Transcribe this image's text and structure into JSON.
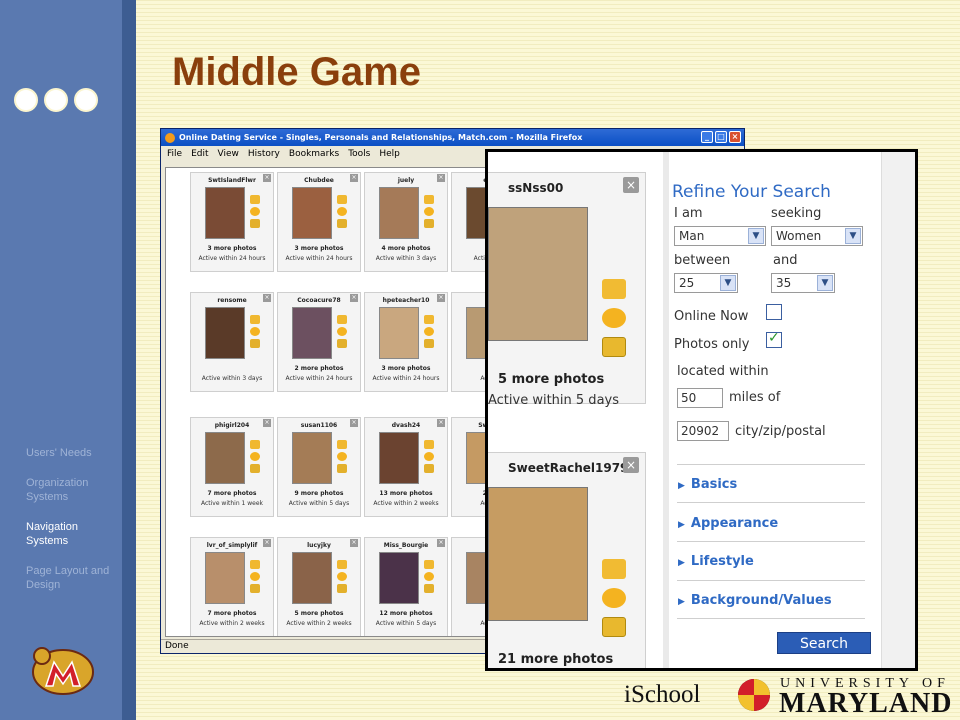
{
  "slide": {
    "title": "Middle Game",
    "nav": [
      "Users' Needs",
      "Organization Systems",
      "Navigation Systems",
      "Page Layout and Design"
    ],
    "active_nav": "Navigation Systems",
    "footer": {
      "ischool": "iSchool",
      "university_top": "UNIVERSITY OF",
      "university_bottom": "MARYLAND"
    }
  },
  "browser": {
    "title": "Online Dating Service - Singles, Personals and Relationships, Match.com - Mozilla Firefox",
    "menu": [
      "File",
      "Edit",
      "View",
      "History",
      "Bookmarks",
      "Tools",
      "Help"
    ],
    "status": "Done",
    "profiles": [
      {
        "name": "SwtIslandFlwr",
        "more": "3 more photos",
        "active": "Active within 24 hours",
        "photo_color": "#7a4b35"
      },
      {
        "name": "Chubdee",
        "more": "3 more photos",
        "active": "Active within 24 hours",
        "photo_color": "#9b6040"
      },
      {
        "name": "juely",
        "more": "4 more photos",
        "active": "Active within 3 days",
        "photo_color": "#a57a58"
      },
      {
        "name": "estrel",
        "more": "",
        "active": "Active within",
        "photo_color": "#6b4a2f"
      },
      {
        "name": "rensome",
        "more": "",
        "active": "Active within 3 days",
        "photo_color": "#5a3a28"
      },
      {
        "name": "Cocoacure78",
        "more": "2 more photos",
        "active": "Active within 24 hours",
        "photo_color": "#6c5060"
      },
      {
        "name": "hpeteacher10",
        "more": "3 more photos",
        "active": "Active within 24 hours",
        "photo_color": "#c9a77f"
      },
      {
        "name": "ssN",
        "more": "5 mo",
        "active": "Active w",
        "photo_color": "#b89a72"
      },
      {
        "name": "phigirl204",
        "more": "7 more photos",
        "active": "Active within 1 week",
        "photo_color": "#8d6a4b"
      },
      {
        "name": "susan1106",
        "more": "9 more photos",
        "active": "Active within 5 days",
        "photo_color": "#a47c56"
      },
      {
        "name": "dvash24",
        "more": "13 more photos",
        "active": "Active within 2 weeks",
        "photo_color": "#6b4330"
      },
      {
        "name": "SweetRa",
        "more": "21 mo",
        "active": "Active w",
        "photo_color": "#c59a63"
      },
      {
        "name": "lvr_of_simplylif",
        "more": "7 more photos",
        "active": "Active within 2 weeks",
        "photo_color": "#b88f6b"
      },
      {
        "name": "lucyjky",
        "more": "5 more photos",
        "active": "Active within 2 weeks",
        "photo_color": "#8a6349"
      },
      {
        "name": "Miss_Bourgie",
        "more": "12 more photos",
        "active": "Active within 5 days",
        "photo_color": "#4b3249"
      },
      {
        "name": "jelle",
        "more": "2 mo",
        "active": "Active w",
        "photo_color": "#a88462"
      }
    ]
  },
  "zoom": {
    "cards": [
      {
        "name": "ssNss00",
        "more": "5 more photos",
        "active": "Active within 5 days",
        "photo_color": "#bfa27b"
      },
      {
        "name": "SweetRachel1979",
        "more": "21 more photos",
        "active": "Active within 5 days",
        "photo_color": "#c69c62"
      }
    ],
    "refine": {
      "title": "Refine Your Search",
      "i_am_label": "I am",
      "seeking_label": "seeking",
      "i_am_value": "Man",
      "seeking_value": "Women",
      "between_label": "between",
      "and_label": "and",
      "age_min": "25",
      "age_max": "35",
      "online_now": "Online Now",
      "photos_only": "Photos only",
      "located_within": "located within",
      "miles_value": "50",
      "miles_of": "miles of",
      "zip_value": "20902",
      "zip_label": "city/zip/postal",
      "sections": [
        "Basics",
        "Appearance",
        "Lifestyle",
        "Background/Values"
      ],
      "search_button": "Search"
    }
  }
}
